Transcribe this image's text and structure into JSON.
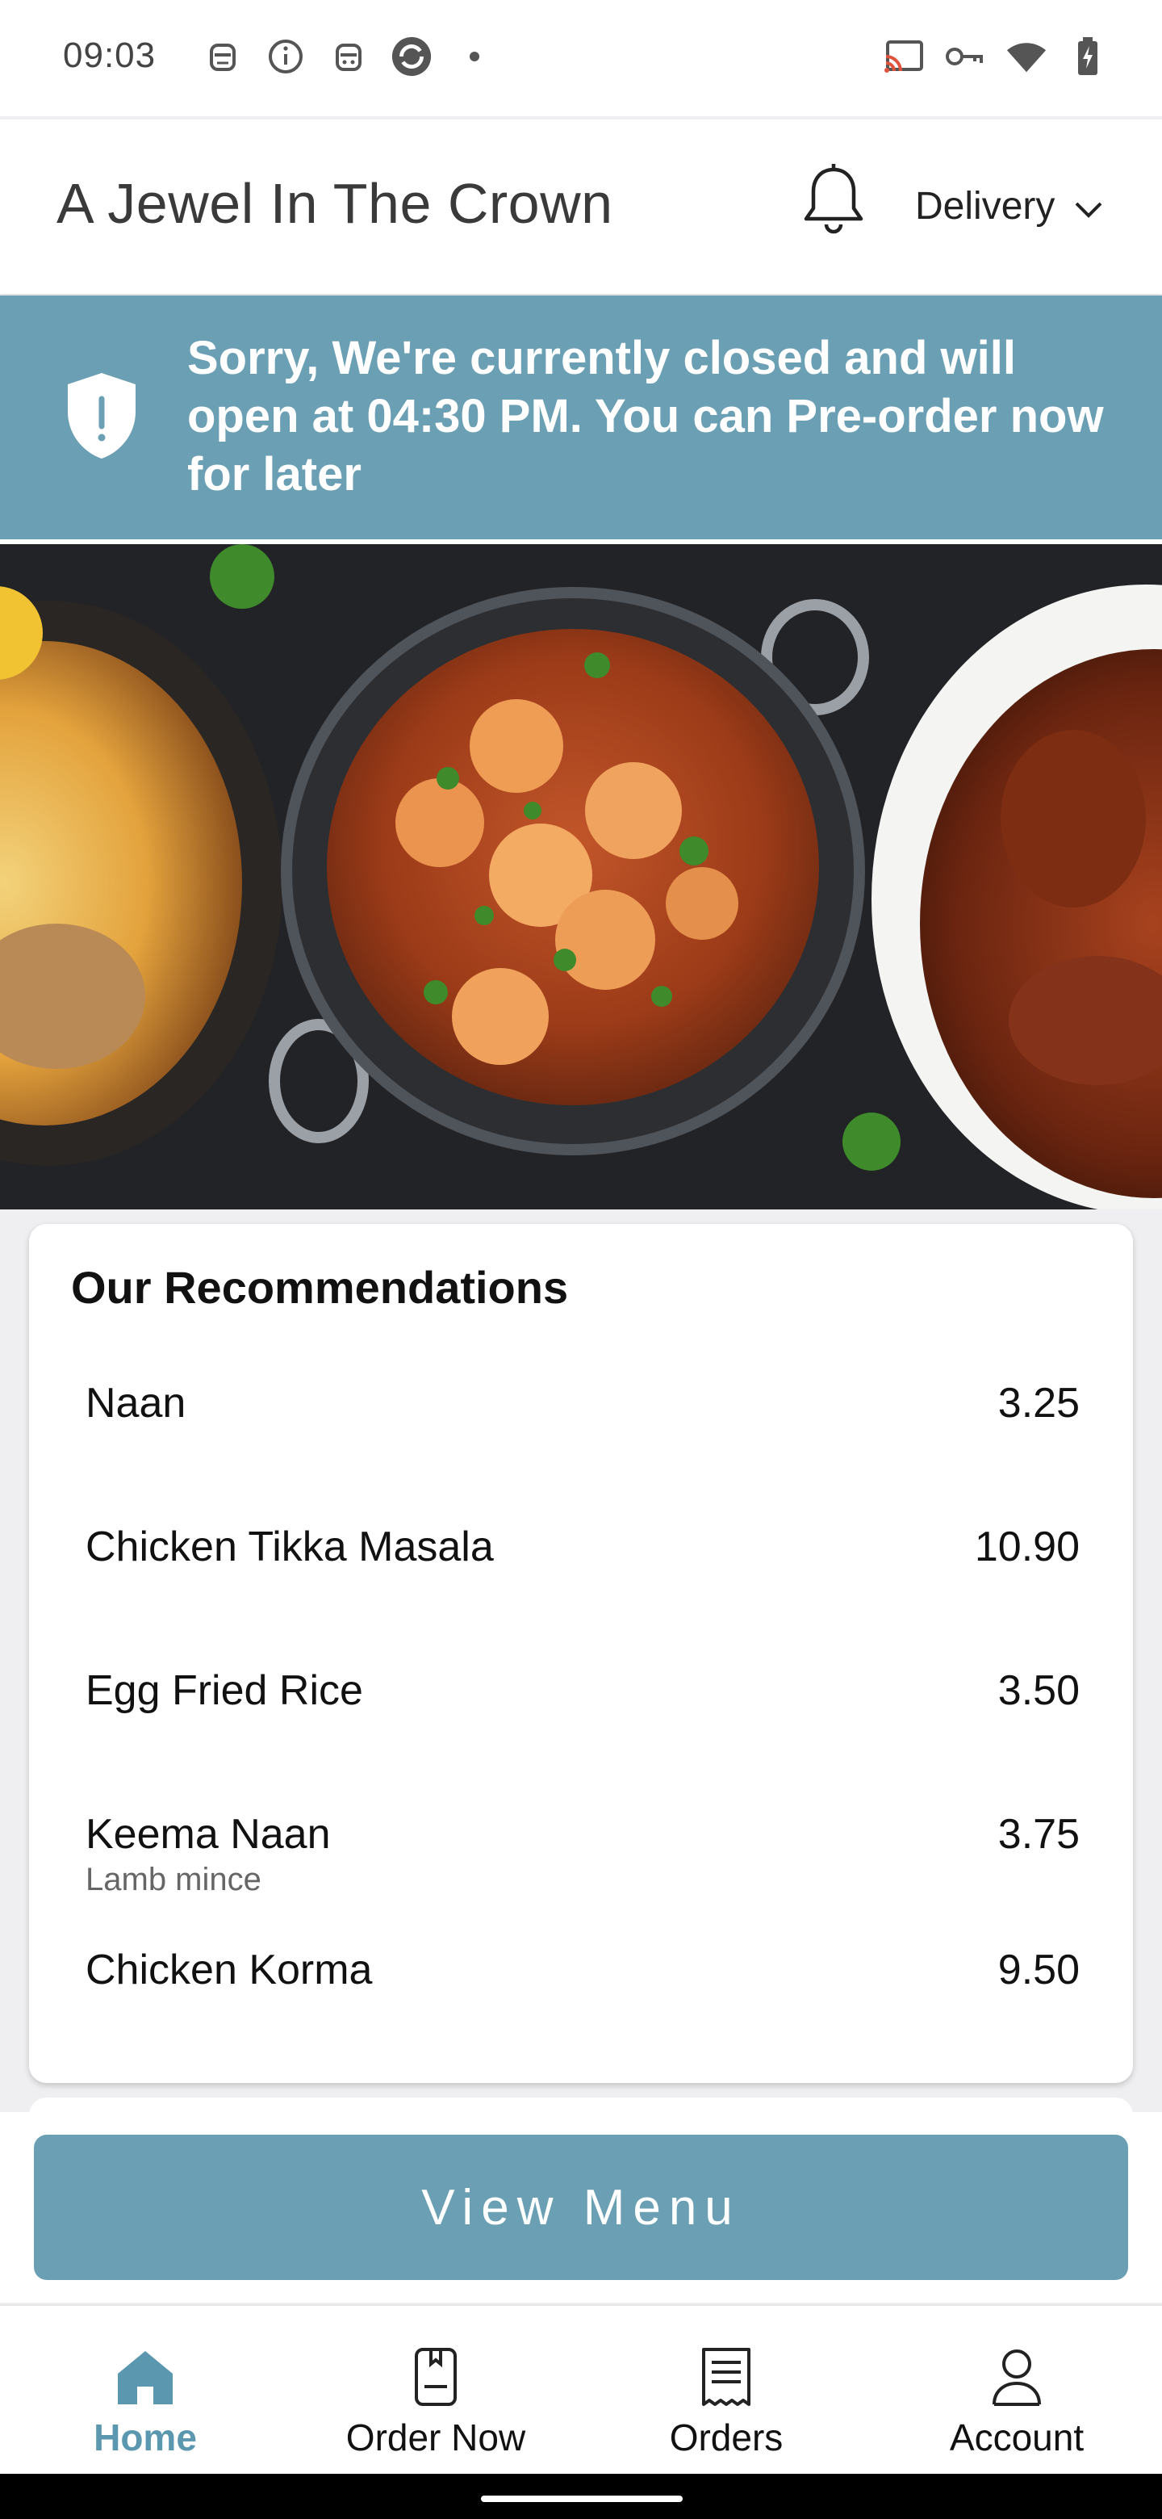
{
  "status_bar": {
    "time": "09:03",
    "left_icons": [
      "robot-face-icon",
      "info-icon",
      "robot-face-icon",
      "sync-app-icon",
      "dot-icon"
    ],
    "right_icons": [
      "cast-icon",
      "vpn-key-icon",
      "wifi-icon",
      "battery-charging-icon"
    ]
  },
  "header": {
    "title": "A Jewel In The Crown",
    "bell_icon": "bell-icon",
    "order_mode": "Delivery",
    "dropdown_icon": "chevron-down-icon"
  },
  "closed_banner": {
    "icon": "shield-alert-icon",
    "message": "Sorry, We're currently closed and will open at 04:30 PM. You can Pre-order now for later",
    "background_color": "#6a9fb4"
  },
  "hero": {
    "image_description_icon": "food-dishes-image"
  },
  "recommendations": {
    "title": "Our Recommendations",
    "items": [
      {
        "name": "Naan",
        "price": "3.25",
        "description": ""
      },
      {
        "name": "Chicken Tikka Masala",
        "price": "10.90",
        "description": ""
      },
      {
        "name": "Egg Fried Rice",
        "price": "3.50",
        "description": ""
      },
      {
        "name": "Keema Naan",
        "price": "3.75",
        "description": "Lamb mince"
      },
      {
        "name": "Chicken Korma",
        "price": "9.50",
        "description": ""
      }
    ]
  },
  "view_menu": {
    "label": "View Menu",
    "color": "#6a9fb4"
  },
  "bottom_nav": {
    "items": [
      {
        "label": "Home",
        "icon": "home-icon",
        "active": true
      },
      {
        "label": "Order Now",
        "icon": "order-book-icon",
        "active": false
      },
      {
        "label": "Orders",
        "icon": "receipt-icon",
        "active": false
      },
      {
        "label": "Account",
        "icon": "person-icon",
        "active": false
      }
    ],
    "active_color": "#5c97b0"
  }
}
